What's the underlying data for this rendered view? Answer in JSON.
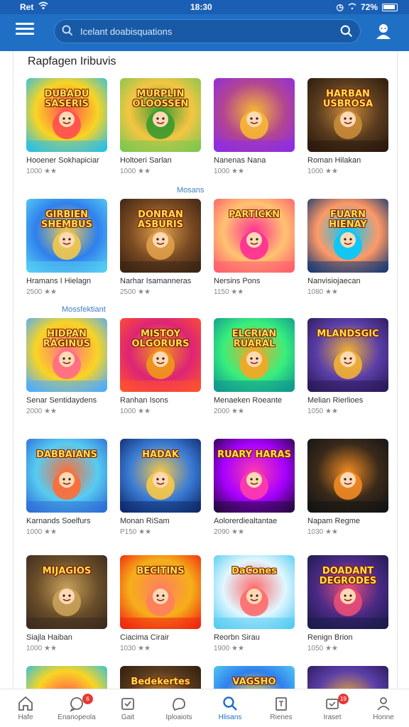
{
  "status_bar": {
    "carrier": "Ret",
    "time": "18:30",
    "battery": "72%"
  },
  "search": {
    "placeholder": "Icelant doabisquations"
  },
  "section_title": "Rapfagen Iribuvis",
  "sub_labels": [
    "Mosans",
    "Mossfektiant"
  ],
  "apps": [
    {
      "name": "Hooener Sokhapiciar",
      "meta": "1000 ★★",
      "art": "DUBADU SASERIS",
      "theme": "candy"
    },
    {
      "name": "Holtoeri Sarlan",
      "meta": "1000 ★★",
      "art": "MURPLIN OLOOSSEN",
      "theme": "farm"
    },
    {
      "name": "Nanenas Nana",
      "meta": "1000 ★★",
      "art": "",
      "theme": "bear"
    },
    {
      "name": "Roman Hilakan",
      "meta": "1000 ★★",
      "art": "HARBAN USBROSA",
      "theme": "dark"
    },
    {
      "name": "Hramans I Hielagn",
      "meta": "2500 ★★",
      "art": "GIRBIEN SHEMBUS",
      "theme": "sky"
    },
    {
      "name": "Narhar Isamanneras",
      "meta": "2500 ★★",
      "art": "DONRAN ASBURIS",
      "theme": "wood"
    },
    {
      "name": "Nersins Pons",
      "meta": "1150 ★★",
      "art": "PARTICKN",
      "theme": "pink"
    },
    {
      "name": "Nanvisiojaecan",
      "meta": "1080 ★★",
      "art": "FUARN HIENAY",
      "theme": "neon"
    },
    {
      "name": "Senar Sentidaydens",
      "meta": "2000 ★★",
      "art": "HIDPAN RAGINUS",
      "theme": "kids"
    },
    {
      "name": "Ranhan Isons",
      "meta": "1000 ★★",
      "art": "MISTOY OLGORURS",
      "theme": "hero"
    },
    {
      "name": "Menaeken Roeante",
      "meta": "2000 ★★",
      "art": "ELCRIAN RUARAL",
      "theme": "party"
    },
    {
      "name": "Melian Rierlioes",
      "meta": "1050 ★★",
      "art": "MLANDSGIC",
      "theme": "king"
    },
    {
      "name": "Karnands Soelfurs",
      "meta": "1000 ★★",
      "art": "DABBAIANS",
      "theme": "face"
    },
    {
      "name": "Monan RiSam",
      "meta": "P150 ★★",
      "art": "HADAK",
      "theme": "boy"
    },
    {
      "name": "Aolorerdiealtantae",
      "meta": "2090 ★★",
      "art": "RUARY HARAS",
      "theme": "galaxy"
    },
    {
      "name": "Napam Regme",
      "meta": "1030 ★★",
      "art": "",
      "theme": "elf"
    },
    {
      "name": "Siajla Haiban",
      "meta": "1000 ★★",
      "art": "MIJAGIOS",
      "theme": "street"
    },
    {
      "name": "Ciacima Cirair",
      "meta": "1030 ★★",
      "art": "BECITINS",
      "theme": "fire"
    },
    {
      "name": "Reorbn Sirau",
      "meta": "1900 ★★",
      "art": "DaCones",
      "theme": "bubble"
    },
    {
      "name": "Renign Brion",
      "meta": "1050 ★★",
      "art": "DOADANT DEGRODES",
      "theme": "ninja"
    },
    {
      "name": "",
      "meta": "",
      "art": "",
      "theme": "candy"
    },
    {
      "name": "",
      "meta": "",
      "art": "Bedekertes",
      "theme": "dark"
    },
    {
      "name": "",
      "meta": "",
      "art": "VAGSHO",
      "theme": "sky"
    },
    {
      "name": "",
      "meta": "",
      "art": "",
      "theme": "king"
    }
  ],
  "nav": [
    {
      "label": "Hafe",
      "icon": "home-icon",
      "badge": ""
    },
    {
      "label": "Enanopeola",
      "icon": "chat-icon",
      "badge": "6"
    },
    {
      "label": "Gait",
      "icon": "calendar-icon",
      "badge": ""
    },
    {
      "label": "Iploaiots",
      "icon": "bubble-icon",
      "badge": ""
    },
    {
      "label": "Hlisans",
      "icon": "search-icon",
      "badge": "",
      "active": true
    },
    {
      "label": "Rienes",
      "icon": "document-icon",
      "badge": ""
    },
    {
      "label": "Iraset",
      "icon": "message-icon",
      "badge": "19"
    },
    {
      "label": "Honne",
      "icon": "profile-icon",
      "badge": ""
    }
  ],
  "colors": {
    "app_bar": "#1f6fc5",
    "status_bar": "#1a5fb4",
    "accent": "#1f6fc5",
    "badge": "#e53935"
  }
}
